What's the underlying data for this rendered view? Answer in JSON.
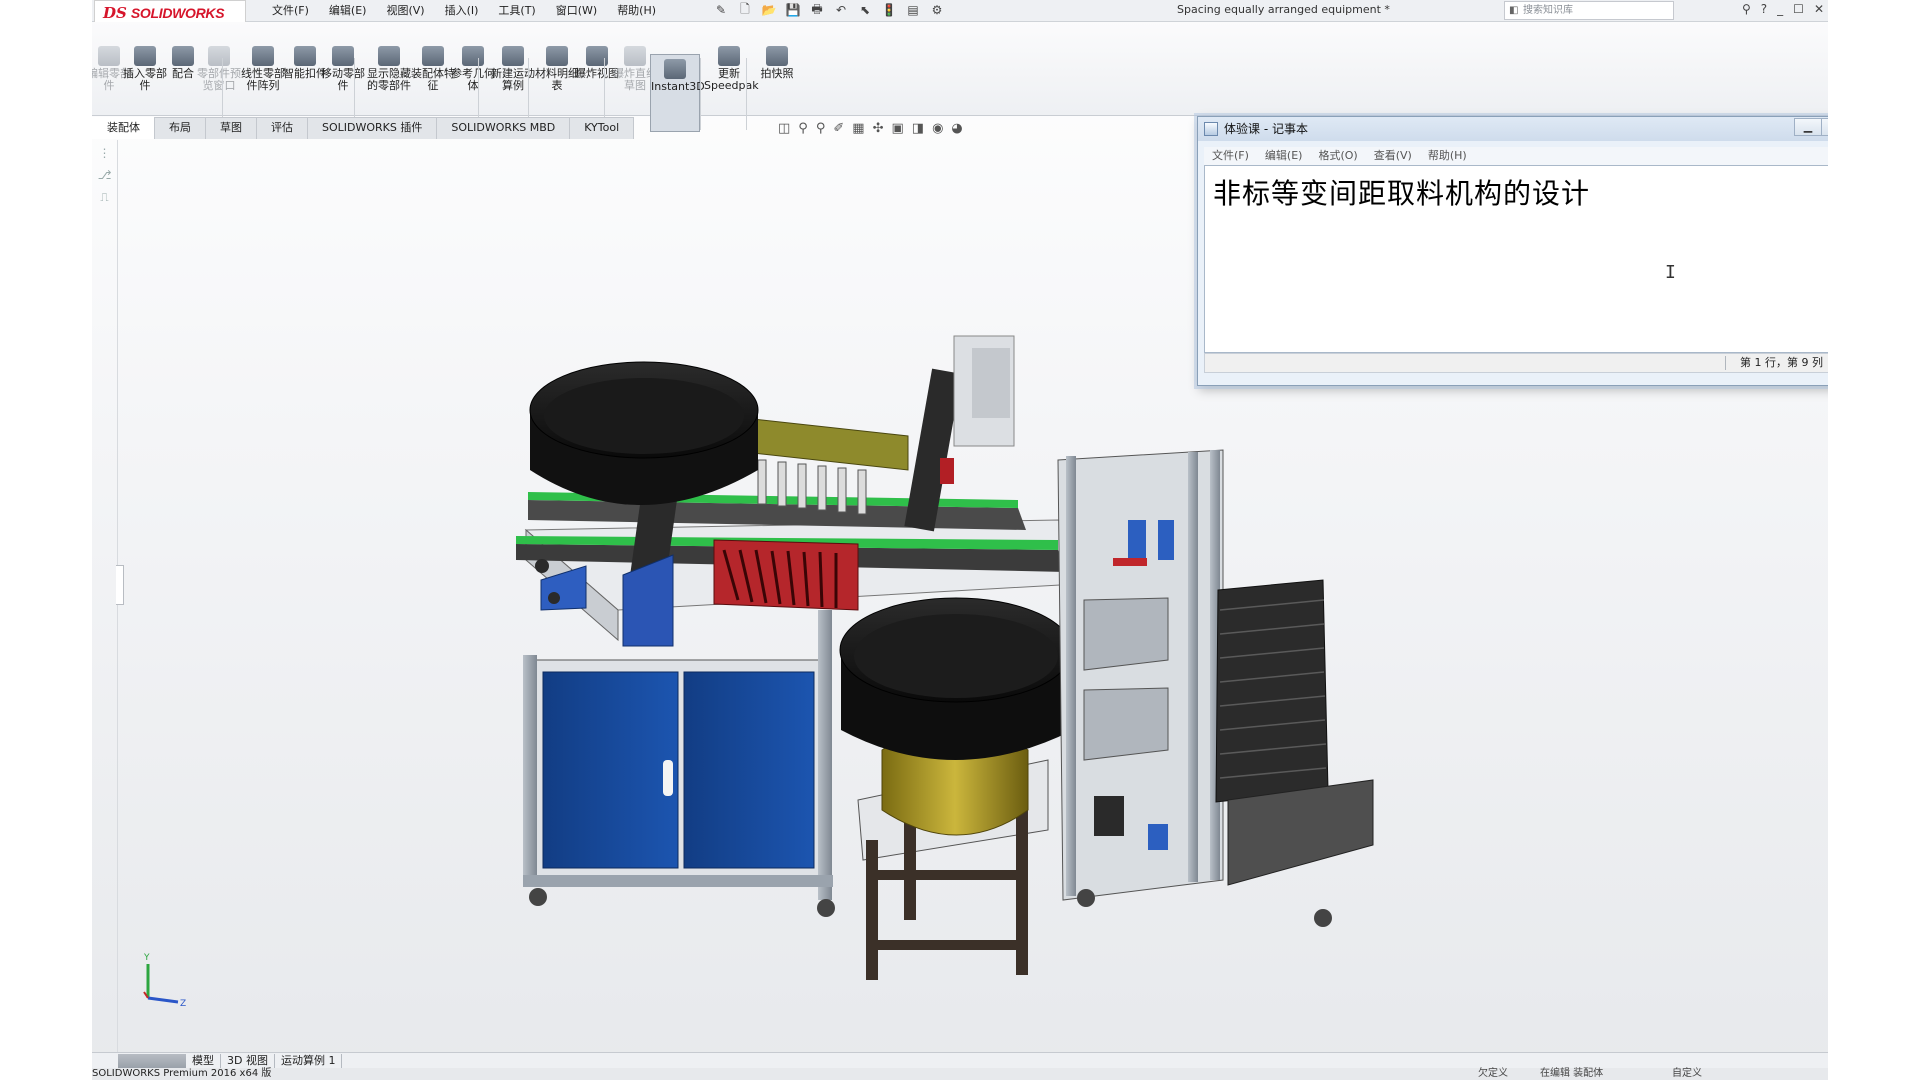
{
  "app": {
    "logo_ds": "DS",
    "logo_text": "SOLIDWORKS",
    "document_title": "Spacing equally arranged equipment *",
    "search_placeholder": "搜索知识库",
    "menu": [
      "文件(F)",
      "编辑(E)",
      "视图(V)",
      "插入(I)",
      "工具(T)",
      "窗口(W)",
      "帮助(H)"
    ]
  },
  "commands": [
    {
      "label": "编辑零部件",
      "dim": true
    },
    {
      "label": "插入零部件",
      "dim": false
    },
    {
      "label": "配合",
      "dim": false
    },
    {
      "label": "零部件预览窗口",
      "dim": true
    },
    {
      "label": "线性零部件阵列",
      "dim": false
    },
    {
      "label": "智能扣件",
      "dim": false
    },
    {
      "label": "移动零部件",
      "dim": false
    },
    {
      "label": "显示隐藏的零部件",
      "dim": false
    },
    {
      "label": "装配体特征",
      "dim": false
    },
    {
      "label": "参考几何体",
      "dim": false
    },
    {
      "label": "新建运动算例",
      "dim": false
    },
    {
      "label": "材料明细表",
      "dim": false
    },
    {
      "label": "爆炸视图",
      "dim": false
    },
    {
      "label": "爆炸直线草图",
      "dim": true
    },
    {
      "label": "Instant3D",
      "dim": false,
      "active": true
    },
    {
      "label": "更新Speedpak",
      "dim": false
    },
    {
      "label": "拍快照",
      "dim": false
    }
  ],
  "tabs": [
    "装配体",
    "布局",
    "草图",
    "评估",
    "SOLIDWORKS 插件",
    "SOLIDWORKS MBD",
    "KYTool"
  ],
  "bottom_tabs": [
    "模型",
    "3D 视图",
    "运动算例 1"
  ],
  "status": {
    "product": "SOLIDWORKS Premium 2016 x64 版",
    "s2": "欠定义",
    "s3": "在编辑 装配体",
    "s4": "自定义"
  },
  "triad": {
    "y": "Y",
    "z": "Z"
  },
  "notepad": {
    "title": "体验课 - 记事本",
    "menu": [
      "文件(F)",
      "编辑(E)",
      "格式(O)",
      "查看(V)",
      "帮助(H)"
    ],
    "content": "非标等变间距取料机构的设计",
    "caret": "I",
    "cursor_position": "第 1 行，第 9 列"
  },
  "colors": {
    "accent_red": "#d6152b",
    "cabinet_blue": "#1a4fa0",
    "frame_grey": "#9aa3ad",
    "bowl_black": "#111111",
    "bowl_base_gold": "#b5a32a"
  }
}
